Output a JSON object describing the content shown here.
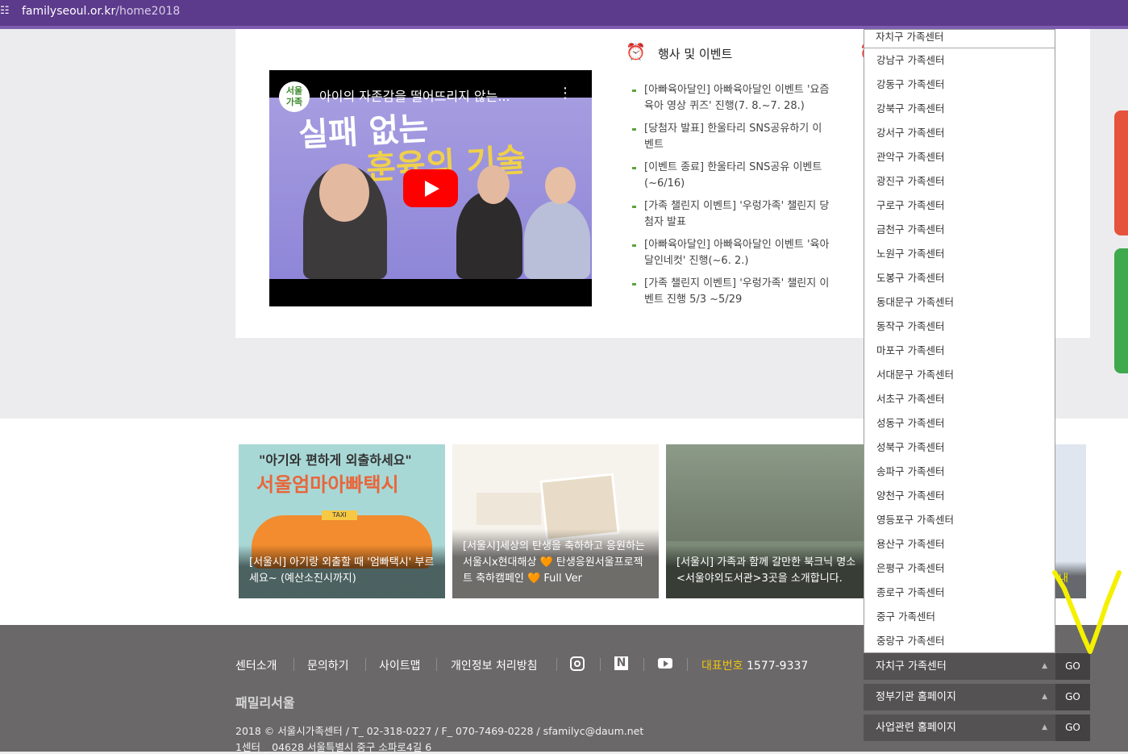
{
  "browser": {
    "url_host": "familyseoul.or.kr",
    "url_path": "/home2018"
  },
  "video": {
    "channel_logo": "서울\n가족",
    "title": "아이의 자존감을 떨어뜨리지 않는...",
    "thumb_line1": "실패 없는",
    "thumb_line2": "훈육의 기술"
  },
  "events": {
    "title": "행사 및 이벤트",
    "items": [
      "[아빠육아달인] 아빠육아달인 이벤트 '요즘육아 영상 퀴즈' 진행(7. 8.~7. 28.)",
      "[당첨자 발표] 한울타리 SNS공유하기 이벤트",
      "[이벤트 종료] 한울타리 SNS공유 이벤트(~6/16)",
      "[가족 챌린지 이벤트] '우렁가족' 챌린지 당첨자 발표",
      "[아빠육아달인] 아빠육아달인 이벤트 '육아달인네컷' 진행(~6. 2.)",
      "[가족 챌린지 이벤트] '우렁가족' 챌린지 이벤트 진행 5/3 ~5/29"
    ]
  },
  "cards": [
    {
      "headline": "\"아기와 편하게 외출하세요\"",
      "brand": "서울엄마아빠택시",
      "sign": "TAXI",
      "caption": "[서울시] 아기랑 외출할 때 '엄빠택시' 부르세요~ (예산소진시까지)"
    },
    {
      "caption": "[서울시]세상의 탄생을 축하하고 응원하는 서울시x현대해상 🧡 탄생응원서울프로젝트 축하캠페인 🧡 Full Ver"
    },
    {
      "caption": "[서울시] 가족과 함께 갈만한 북크닉 명소 <서울야외도서관>3곳을 소개합니다."
    },
    {
      "caption": "내"
    }
  ],
  "footer": {
    "links": [
      "센터소개",
      "문의하기",
      "사이트맵",
      "개인정보 처리방침"
    ],
    "social_icons": [
      "instagram-icon",
      "naver-icon",
      "youtube-icon"
    ],
    "phone_label": "대표번호",
    "phone": "1577-9337",
    "logo": "패밀리서울",
    "info1": "2018 © 서울시가족센터 / T_ 02-318-0227 / F_ 070-7469-0228 / sfamilyc@daum.net",
    "info2": "1센터 _ 04628 서울특별시 중구 소파로4길 6",
    "selects": [
      {
        "label": "자치구 가족센터",
        "go": "GO"
      },
      {
        "label": "정부기관 홈페이지",
        "go": "GO"
      },
      {
        "label": "사업관련 홈페이지",
        "go": "GO"
      }
    ]
  },
  "dropdown": {
    "header": "자치구 가족센터",
    "options": [
      "강남구 가족센터",
      "강동구 가족센터",
      "강북구 가족센터",
      "강서구 가족센터",
      "관악구 가족센터",
      "광진구 가족센터",
      "구로구 가족센터",
      "금천구 가족센터",
      "노원구 가족센터",
      "도봉구 가족센터",
      "동대문구 가족센터",
      "동작구 가족센터",
      "마포구 가족센터",
      "서대문구 가족센터",
      "서초구 가족센터",
      "성동구 가족센터",
      "성북구 가족센터",
      "송파구 가족센터",
      "양천구 가족센터",
      "영등포구 가족센터",
      "용산구 가족센터",
      "은평구 가족센터",
      "종로구 가족센터",
      "중구 가족센터",
      "중랑구 가족센터"
    ]
  },
  "colors": {
    "browser_bar": "#5c3a8c",
    "accent_green": "#5da33b",
    "accent_red": "#e2483d",
    "phone_label": "#f1c40f",
    "annotation": "#f4f000"
  }
}
